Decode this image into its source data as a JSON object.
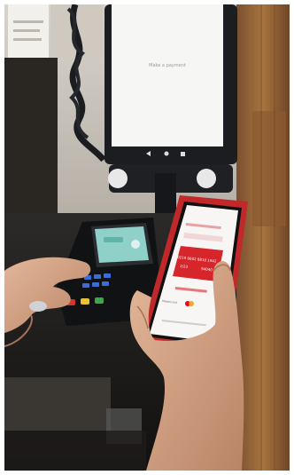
{
  "photo": {
    "description_free": true,
    "monitor_screen": {
      "message": "Make a payment"
    },
    "phone_screen": {
      "card_number": "0219 6602 8810 1942",
      "expiry": "2/23",
      "balance": "94040",
      "card_brand_text": "Mastercard"
    }
  },
  "colors": {
    "phone_case": "#c0282a",
    "card_red": "#d6262b",
    "terminal_screen": "#8fd0c8",
    "wood": "#9a6a3e"
  }
}
